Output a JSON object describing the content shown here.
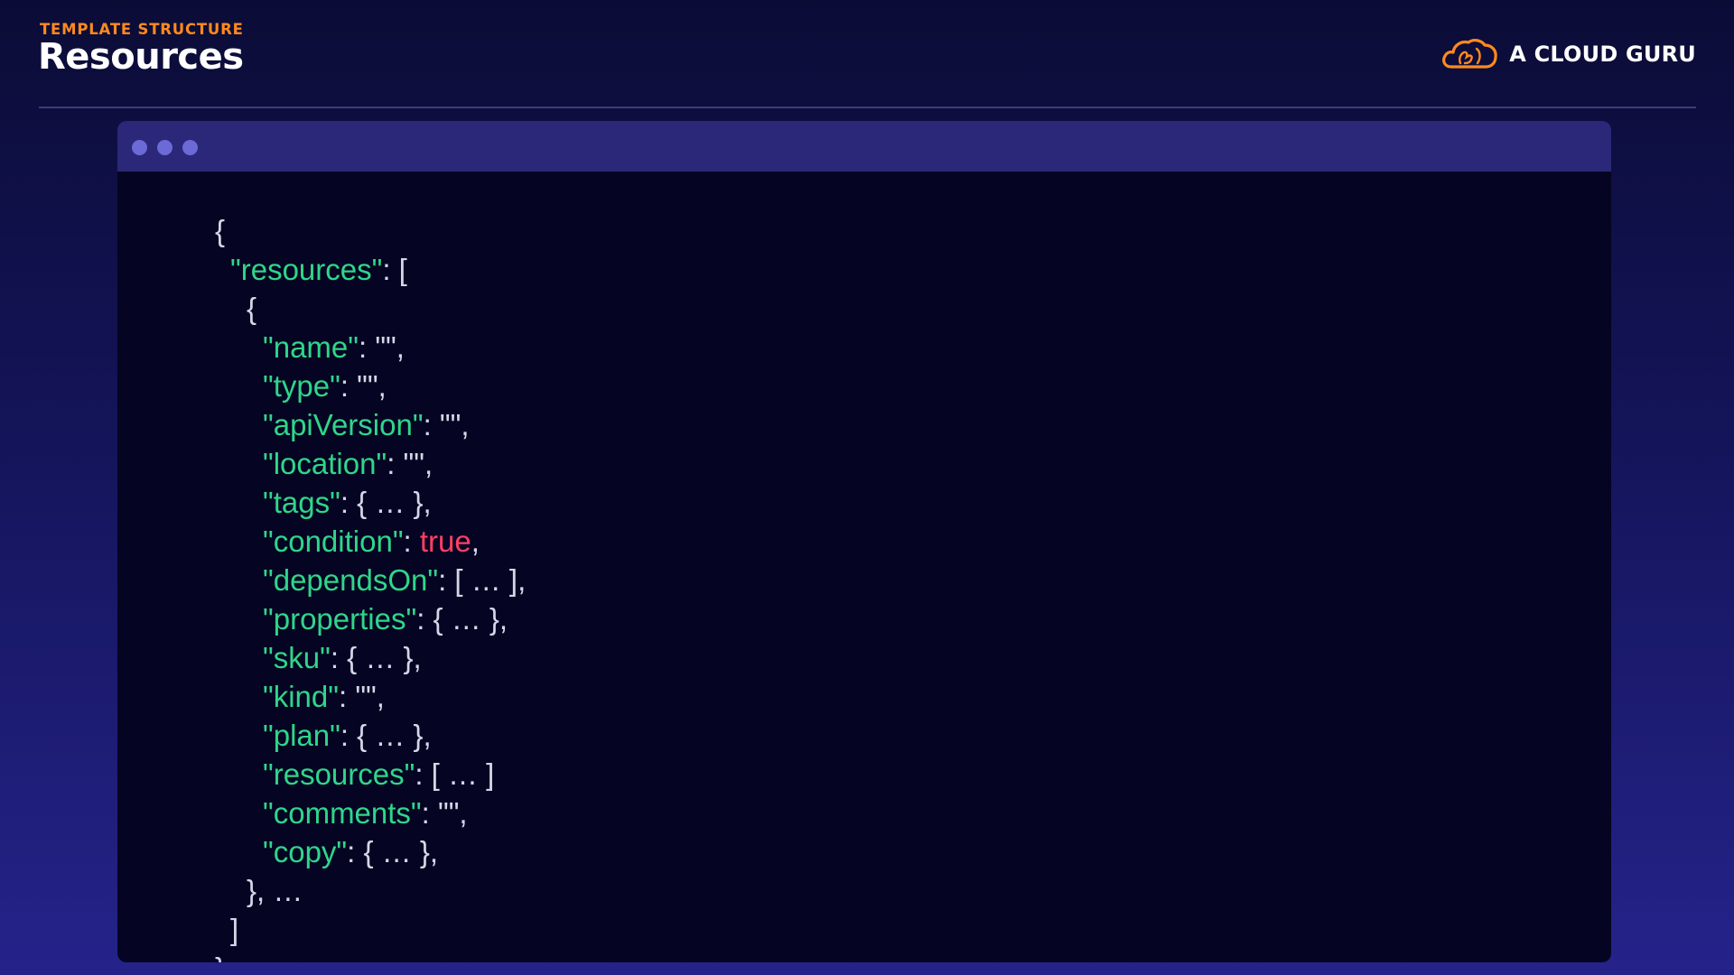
{
  "header": {
    "eyebrow": "TEMPLATE STRUCTURE",
    "title": "Resources"
  },
  "brand": {
    "name": "A CLOUD GURU",
    "logo_icon": "cloud-logo-icon"
  },
  "colors": {
    "accent": "#ff8a1e",
    "json_key": "#2fd68a",
    "json_boolean": "#ff3f66",
    "json_punctuation": "#d6d6e8",
    "code_background": "#050523",
    "window_titlebar": "#2b2879",
    "window_dots": "#6b6ad6"
  },
  "code": {
    "open_brace": "{",
    "resources_key": "\"resources\"",
    "resources_open": ": [",
    "item_open": "{",
    "fields": {
      "name_key": "\"name\"",
      "name_rest": ": \"\",",
      "type_key": "\"type\"",
      "type_rest": ": \"\",",
      "apiVersion_key": "\"apiVersion\"",
      "apiVersion_rest": ": \"\",",
      "location_key": "\"location\"",
      "location_rest": ": \"\",",
      "tags_key": "\"tags\"",
      "tags_rest": ": { … },",
      "condition_key": "\"condition\"",
      "condition_sep": ": ",
      "condition_value": "true",
      "condition_end": ",",
      "dependsOn_key": "\"dependsOn\"",
      "dependsOn_rest": ": [ … ],",
      "properties_key": "\"properties\"",
      "properties_rest": ": { … },",
      "sku_key": "\"sku\"",
      "sku_rest": ": { … },",
      "kind_key": "\"kind\"",
      "kind_rest": ": \"\",",
      "plan_key": "\"plan\"",
      "plan_rest": ": { … },",
      "resources_key": "\"resources\"",
      "resources_rest": ": [ … ]",
      "comments_key": "\"comments\"",
      "comments_rest": ": \"\",",
      "copy_key": "\"copy\"",
      "copy_rest": ": { … },"
    },
    "item_close": "}, …",
    "array_close": "]",
    "close_brace": "}"
  }
}
